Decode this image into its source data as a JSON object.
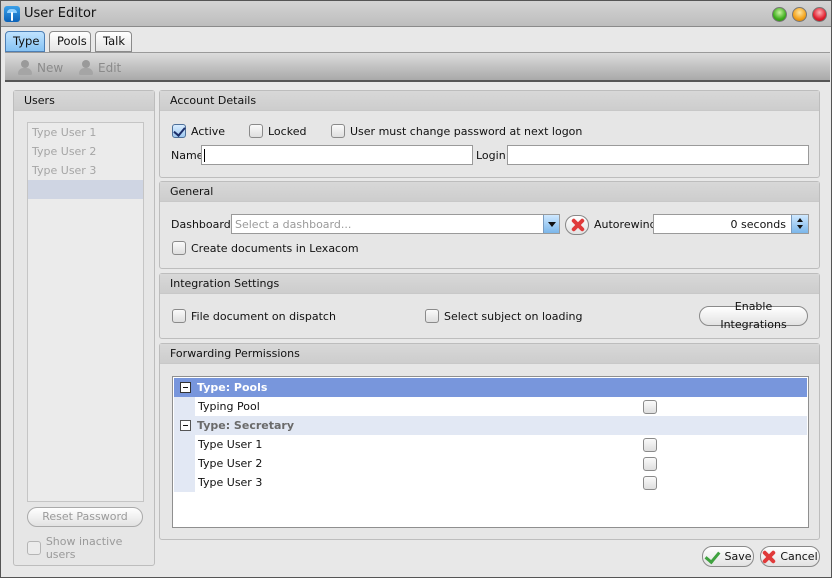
{
  "window": {
    "title": "User Editor",
    "controls": [
      "minimize",
      "maximize",
      "close"
    ]
  },
  "tabs": [
    {
      "label": "Type",
      "active": true
    },
    {
      "label": "Pools",
      "active": false
    },
    {
      "label": "Talk",
      "active": false
    }
  ],
  "toolbar": {
    "new_label": "New",
    "edit_label": "Edit",
    "new_icon": "add-user-icon",
    "edit_icon": "edit-user-icon"
  },
  "users_panel": {
    "title": "Users",
    "items": [
      "Type User 1",
      "Type User 2",
      "Type User 3",
      ""
    ],
    "selected_index": 3,
    "reset_password_label": "Reset Password",
    "show_inactive_label": "Show inactive users",
    "show_inactive_checked": false
  },
  "account_details": {
    "title": "Account Details",
    "active_label": "Active",
    "active_checked": true,
    "locked_label": "Locked",
    "locked_checked": false,
    "must_change_label": "User must change password at next logon",
    "must_change_checked": false,
    "name_label": "Name",
    "name_value": "",
    "login_label": "Login",
    "login_value": ""
  },
  "general": {
    "title": "General",
    "dashboard_label": "Dashboard",
    "dashboard_placeholder": "Select a dashboard...",
    "autorewind_label": "Autorewind",
    "autorewind_value": "0 seconds",
    "create_docs_label": "Create documents in Lexacom",
    "create_docs_checked": false
  },
  "integration": {
    "title": "Integration Settings",
    "file_doc_label": "File document on dispatch",
    "file_doc_checked": false,
    "select_subject_label": "Select subject on loading",
    "select_subject_checked": false,
    "enable_button_label": "Enable Integrations"
  },
  "forwarding": {
    "title": "Forwarding Permissions",
    "groups": [
      {
        "label": "Type: Pools",
        "selected": true,
        "items": [
          {
            "label": "Typing Pool",
            "checked": false
          }
        ]
      },
      {
        "label": "Type: Secretary",
        "selected": false,
        "items": [
          {
            "label": "Type User 1",
            "checked": false
          },
          {
            "label": "Type User 2",
            "checked": false
          },
          {
            "label": "Type User 3",
            "checked": false
          }
        ]
      }
    ]
  },
  "footer": {
    "save_label": "Save",
    "cancel_label": "Cancel"
  }
}
